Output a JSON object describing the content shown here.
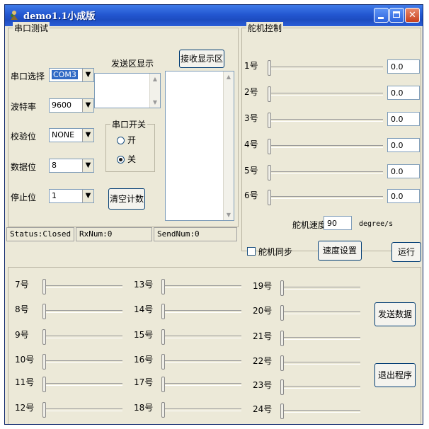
{
  "window": {
    "title": "demo1.1小成版"
  },
  "serial": {
    "group_title": "串口测试",
    "port_label": "串口选择",
    "port_value": "COM3",
    "baud_label": "波特率",
    "baud_value": "9600",
    "parity_label": "校验位",
    "parity_value": "NONE",
    "databits_label": "数据位",
    "databits_value": "8",
    "stopbits_label": "停止位",
    "stopbits_value": "1",
    "send_display_label": "发送区显示",
    "recv_display_button": "接收显示区",
    "switch_group_title": "串口开关",
    "open_label": "开",
    "close_label": "关",
    "clear_count_button": "清空计数"
  },
  "status": {
    "status": "Status:Closed",
    "rx": "RxNum:0",
    "send": "SendNum:0"
  },
  "servo": {
    "group_title": "舵机控制",
    "rows": [
      {
        "label": "1号",
        "value": "0.0"
      },
      {
        "label": "2号",
        "value": "0.0"
      },
      {
        "label": "3号",
        "value": "0.0"
      },
      {
        "label": "4号",
        "value": "0.0"
      },
      {
        "label": "5号",
        "value": "0.0"
      },
      {
        "label": "6号",
        "value": "0.0"
      }
    ],
    "speed_label": "舵机速度",
    "speed_value": "90",
    "speed_unit": "degree/s",
    "sync_label": "舵机同步",
    "speed_set_button": "速度设置",
    "run_button": "运行"
  },
  "sliders": {
    "col1": [
      "7号",
      "8号",
      "9号",
      "10号",
      "11号",
      "12号"
    ],
    "col2": [
      "13号",
      "14号",
      "15号",
      "16号",
      "17号",
      "18号"
    ],
    "col3": [
      "19号",
      "20号",
      "21号",
      "22号",
      "23号",
      "24号"
    ]
  },
  "actions": {
    "send_button": "发送数据",
    "exit_button": "退出程序"
  }
}
